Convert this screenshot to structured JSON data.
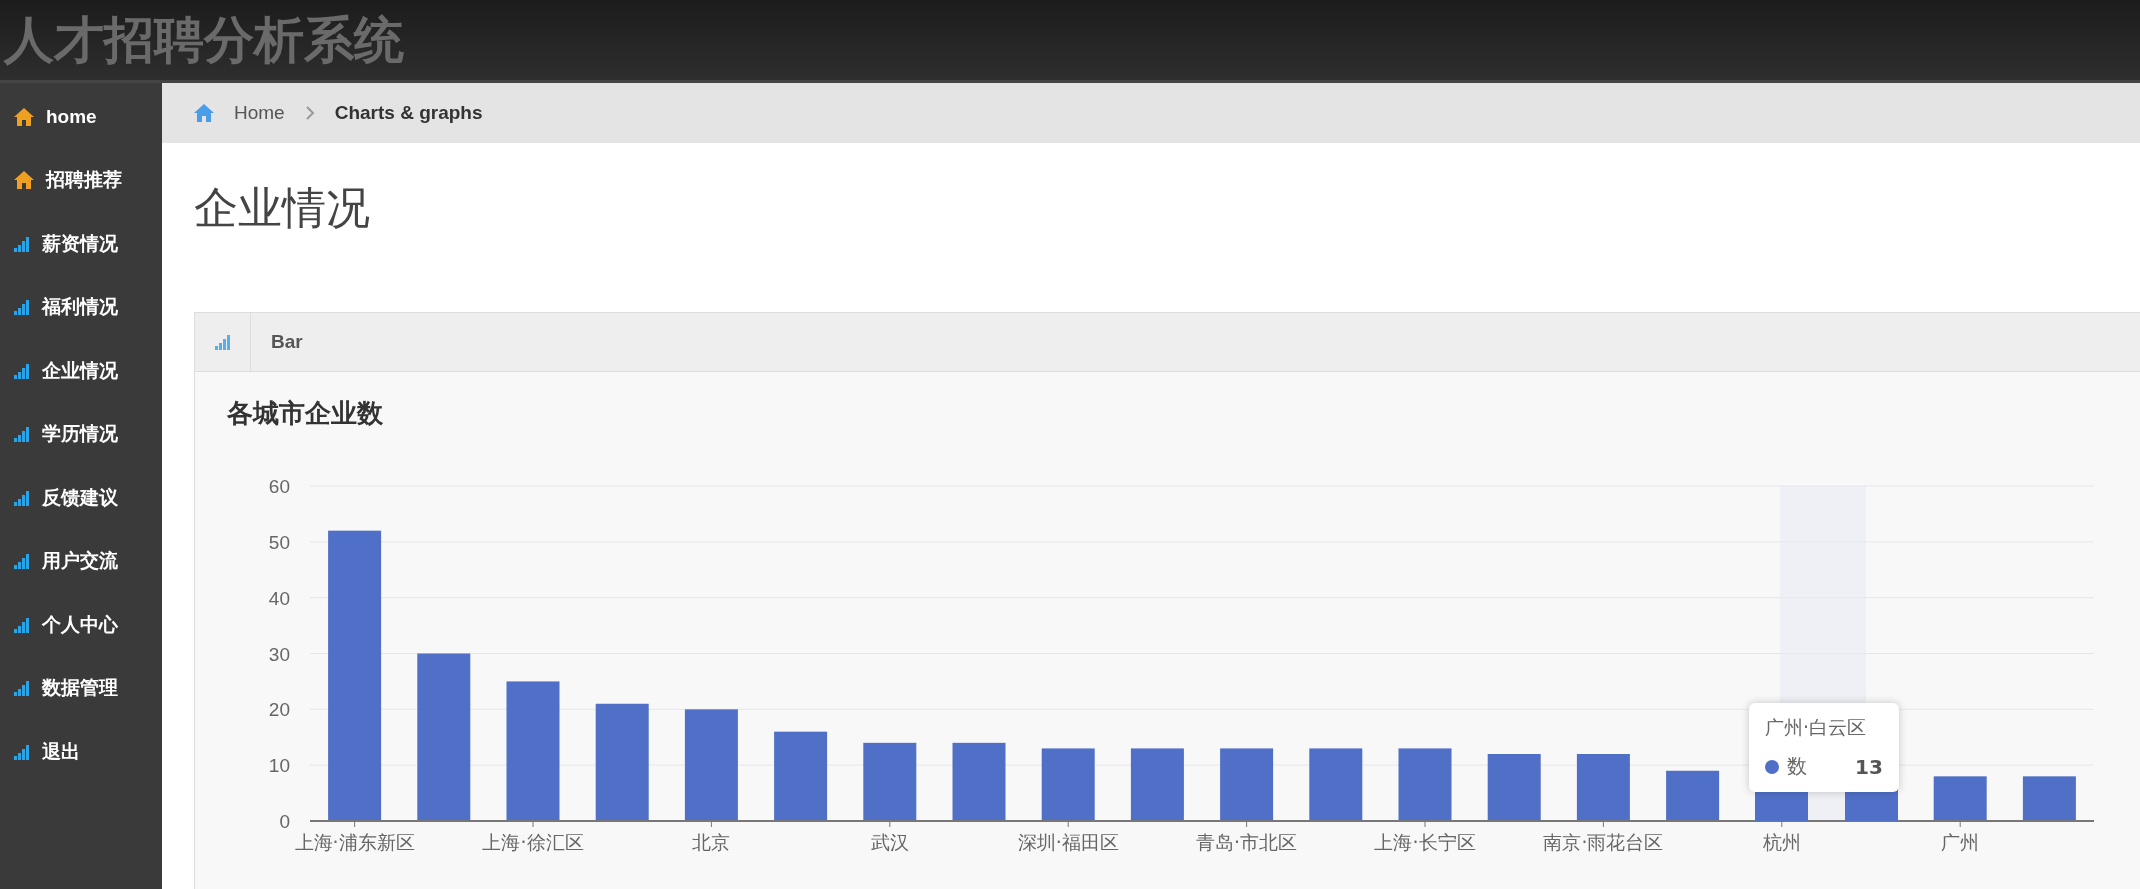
{
  "app_title": "人才招聘分析系统",
  "sidebar": {
    "items": [
      {
        "label": "home",
        "kind": "home",
        "selected": false
      },
      {
        "label": "招聘推荐",
        "kind": "home",
        "selected": false
      },
      {
        "label": "薪资情况",
        "kind": "bars",
        "selected": false
      },
      {
        "label": "福利情况",
        "kind": "bars",
        "selected": false
      },
      {
        "label": "企业情况",
        "kind": "bars",
        "selected": false
      },
      {
        "label": "学历情况",
        "kind": "bars",
        "selected": false
      },
      {
        "label": "反馈建议",
        "kind": "bars",
        "selected": false
      },
      {
        "label": "用户交流",
        "kind": "bars",
        "selected": false
      },
      {
        "label": "个人中心",
        "kind": "bars",
        "selected": false
      },
      {
        "label": "数据管理",
        "kind": "bars",
        "selected": false
      },
      {
        "label": "退出",
        "kind": "bars",
        "selected": false
      }
    ]
  },
  "breadcrumb": [
    {
      "label": "Home"
    },
    {
      "label": "Charts & graphs"
    }
  ],
  "page_title": "企业情况",
  "panel": {
    "tab": "Bar",
    "chart_data": {
      "type": "bar",
      "title": "各城市企业数",
      "categories": [
        "上海·浦东新区",
        null,
        "上海·徐汇区",
        null,
        "北京",
        null,
        "武汉",
        null,
        "深圳·福田区",
        null,
        "青岛·市北区",
        null,
        "上海·长宁区",
        null,
        "南京·雨花台区",
        null,
        "杭州",
        null,
        "广州",
        null
      ],
      "series": [
        {
          "name": "数",
          "color": "#5070c8",
          "values": [
            52,
            30,
            25,
            21,
            20,
            16,
            14,
            14,
            13,
            13,
            13,
            13,
            13,
            12,
            12,
            9,
            null,
            null,
            8,
            8
          ]
        }
      ],
      "ylim": [
        0,
        60
      ],
      "yticks": [
        0,
        10,
        20,
        30,
        40,
        50,
        60
      ],
      "grid": true
    },
    "tooltip": {
      "title": "广州·白云区",
      "value": "13"
    }
  }
}
